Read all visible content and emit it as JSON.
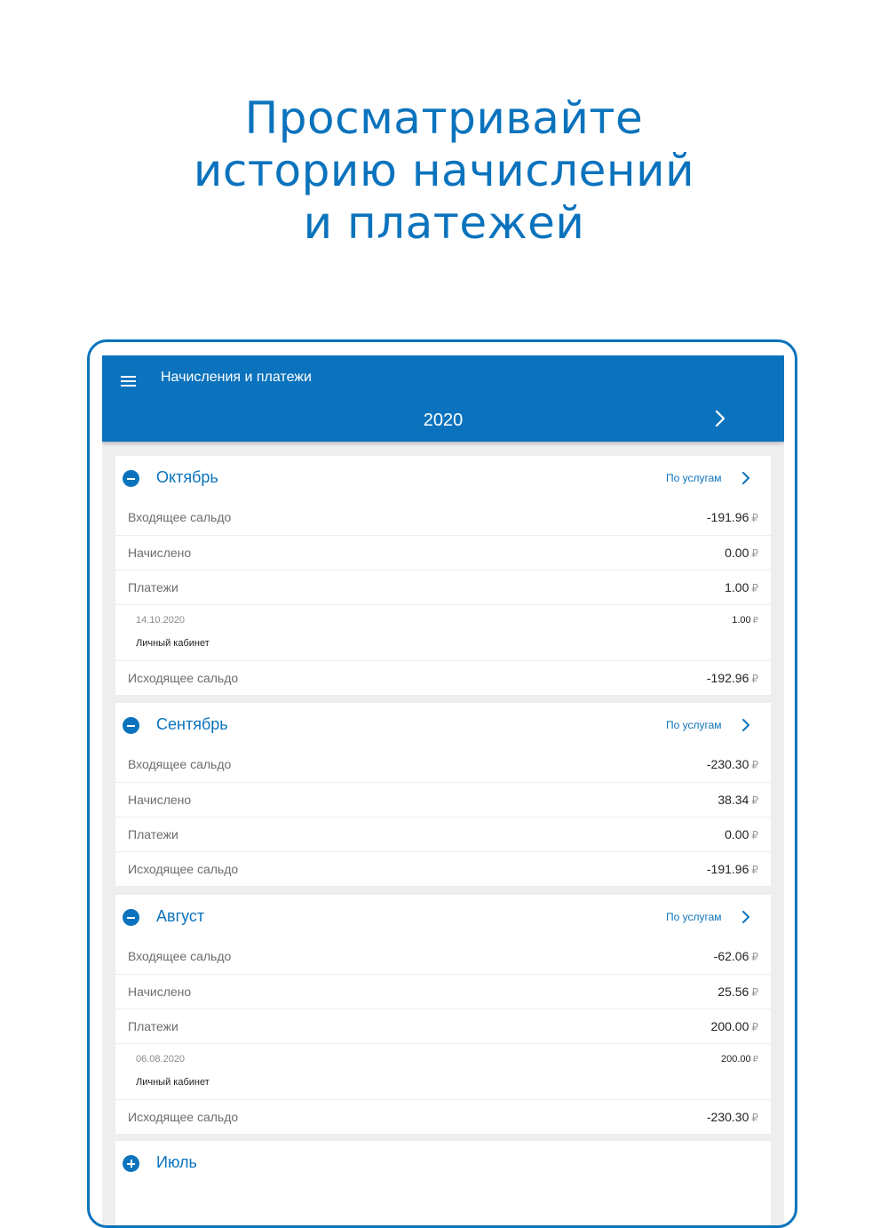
{
  "promo": {
    "line1": "Просматривайте",
    "line2": "историю начислений",
    "line3": "и платежей"
  },
  "colors": {
    "accent": "#0b73bd",
    "background": "#eeeeee",
    "card": "#ffffff"
  },
  "appbar": {
    "menu_icon": "hamburger-menu-icon",
    "title": "Начисления и платежи",
    "year": "2020",
    "next_icon": "chevron-right-icon"
  },
  "currency": "₽",
  "months": [
    {
      "name": "Октябрь",
      "state": "expanded",
      "toggle_icon": "minus-circle-icon",
      "services_label": "По услугам",
      "rows": {
        "opening_label": "Входящее сальдо",
        "opening_value": "-191.96",
        "charged_label": "Начислено",
        "charged_value": "0.00",
        "payments_label": "Платежи",
        "payments_value": "1.00",
        "closing_label": "Исходящее сальдо",
        "closing_value": "-192.96"
      },
      "payments": [
        {
          "date": "14.10.2020",
          "source": "Личный кабинет",
          "amount": "1.00"
        }
      ]
    },
    {
      "name": "Сентябрь",
      "state": "expanded",
      "toggle_icon": "minus-circle-icon",
      "services_label": "По услугам",
      "rows": {
        "opening_label": "Входящее сальдо",
        "opening_value": "-230.30",
        "charged_label": "Начислено",
        "charged_value": "38.34",
        "payments_label": "Платежи",
        "payments_value": "0.00",
        "closing_label": "Исходящее сальдо",
        "closing_value": "-191.96"
      },
      "payments": []
    },
    {
      "name": "Август",
      "state": "expanded",
      "toggle_icon": "minus-circle-icon",
      "services_label": "По услугам",
      "rows": {
        "opening_label": "Входящее сальдо",
        "opening_value": "-62.06",
        "charged_label": "Начислено",
        "charged_value": "25.56",
        "payments_label": "Платежи",
        "payments_value": "200.00",
        "closing_label": "Исходящее сальдо",
        "closing_value": "-230.30"
      },
      "payments": [
        {
          "date": "06.08.2020",
          "source": "Личный кабинет",
          "amount": "200.00"
        }
      ]
    },
    {
      "name": "Июль",
      "state": "collapsed",
      "toggle_icon": "plus-circle-icon"
    }
  ]
}
